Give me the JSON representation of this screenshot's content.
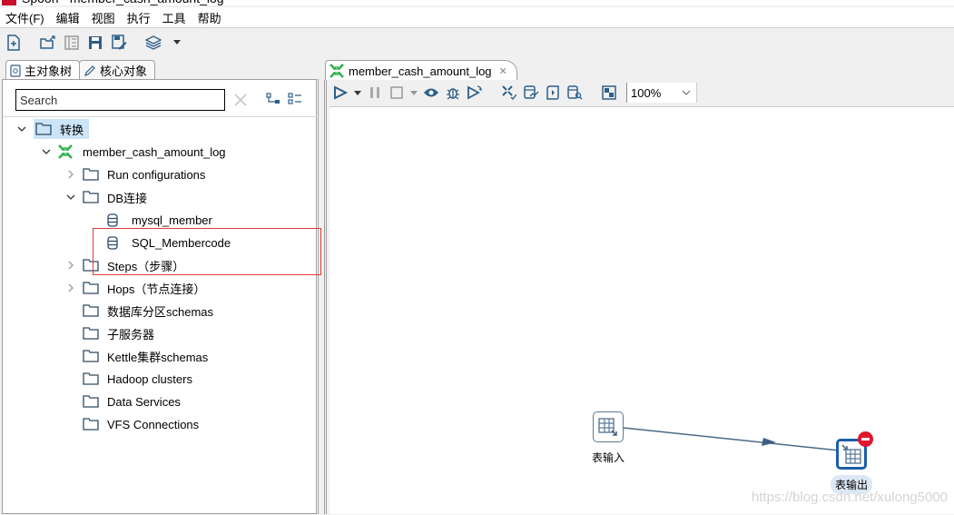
{
  "window": {
    "title": "Spoon - member_cash_amount_log"
  },
  "menubar": {
    "items": [
      "文件(F)",
      "编辑",
      "视图",
      "执行",
      "工具",
      "帮助"
    ]
  },
  "main_toolbar": {
    "buttons": [
      "new-file-icon",
      "open-file-icon",
      "explore-repository-icon",
      "save-icon",
      "save-as-icon",
      "perspective-layers-icon",
      "dropdown-arrow-icon"
    ]
  },
  "left_panel": {
    "tabs": [
      {
        "label": "主对象树",
        "icon": "document-search-icon",
        "active": true
      },
      {
        "label": "核心对象",
        "icon": "pencil-icon",
        "active": false
      }
    ],
    "search": {
      "placeholder": "Search",
      "value": ""
    },
    "tree": [
      {
        "label": "转换",
        "level": 0,
        "expanded": true,
        "icon": "folder-icon",
        "selected": true
      },
      {
        "label": "member_cash_amount_log",
        "level": 1,
        "expanded": true,
        "icon": "transformation-icon"
      },
      {
        "label": "Run configurations",
        "level": 2,
        "expanded": false,
        "icon": "folder-icon"
      },
      {
        "label": "DB连接",
        "level": 2,
        "expanded": true,
        "icon": "folder-icon"
      },
      {
        "label": "mysql_member",
        "level": 3,
        "icon": "database-icon"
      },
      {
        "label": "SQL_Membercode",
        "level": 3,
        "icon": "database-icon"
      },
      {
        "label": "Steps（步骤）",
        "level": 2,
        "expanded": false,
        "icon": "folder-icon"
      },
      {
        "label": "Hops（节点连接）",
        "level": 2,
        "expanded": false,
        "icon": "folder-icon"
      },
      {
        "label": "数据库分区schemas",
        "level": 2,
        "icon": "folder-icon"
      },
      {
        "label": "子服务器",
        "level": 2,
        "icon": "folder-icon"
      },
      {
        "label": "Kettle集群schemas",
        "level": 2,
        "icon": "folder-icon"
      },
      {
        "label": "Hadoop clusters",
        "level": 2,
        "icon": "folder-icon"
      },
      {
        "label": "Data Services",
        "level": 2,
        "icon": "folder-icon"
      },
      {
        "label": "VFS Connections",
        "level": 2,
        "icon": "folder-icon"
      }
    ]
  },
  "editor": {
    "tab": {
      "label": "member_cash_amount_log",
      "close": "✕"
    },
    "toolbar": {
      "zoom": "100%"
    },
    "canvas": {
      "steps": [
        {
          "name": "表输入",
          "type": "table-input",
          "selected": false
        },
        {
          "name": "表输出",
          "type": "table-output",
          "selected": true,
          "error": true
        }
      ],
      "hops": [
        {
          "from": "表输入",
          "to": "表输出"
        }
      ]
    },
    "watermark": "https://blog.csdn.net/xulong5000"
  },
  "colors": {
    "accent": "#1a5ea6",
    "selection": "#cce4f7",
    "error": "#e0182d",
    "highlight_border": "#e03a3a",
    "transform_green": "#2db04b"
  }
}
